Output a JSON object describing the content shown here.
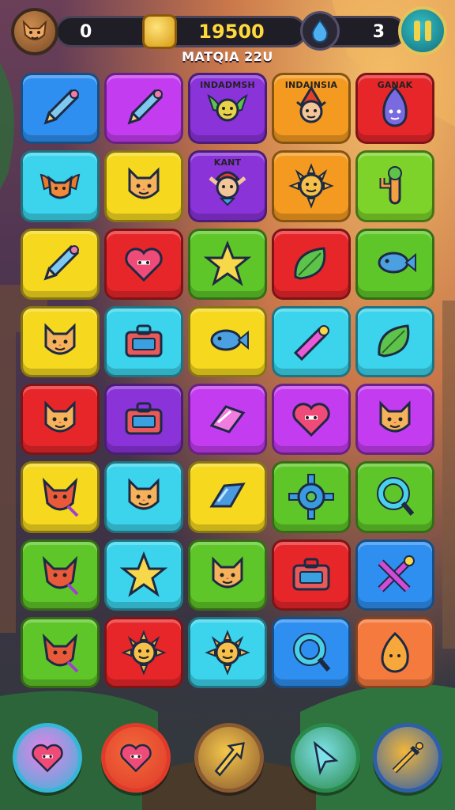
{
  "hud": {
    "left_value": "0",
    "score": "19500",
    "right_value": "3"
  },
  "level_label": "MATQIA 22U",
  "colors": {
    "blue": "#2f8ff0",
    "magenta": "#c43cf0",
    "purple": "#8a33d9",
    "orange": "#f59a20",
    "red": "#e7262a",
    "cyan": "#3bd4ec",
    "yellow": "#f6d81f",
    "green": "#5fc629",
    "lime": "#7ed32a",
    "coral": "#f47a3e"
  },
  "board": {
    "rows": [
      [
        {
          "color": "blue",
          "icon": "pencil-icon",
          "label": ""
        },
        {
          "color": "magenta",
          "icon": "pencil-icon",
          "label": ""
        },
        {
          "color": "purple",
          "icon": "winged-creature-icon",
          "label": "INDADMSH"
        },
        {
          "color": "orange",
          "icon": "gnome-icon",
          "label": "INDAINSIA"
        },
        {
          "color": "red",
          "icon": "flame-creature-icon",
          "label": "GANAK"
        }
      ],
      [
        {
          "color": "cyan",
          "icon": "winged-fox-icon",
          "label": ""
        },
        {
          "color": "yellow",
          "icon": "cat-face-icon",
          "label": ""
        },
        {
          "color": "purple",
          "icon": "elf-icon",
          "label": "KANT"
        },
        {
          "color": "orange",
          "icon": "sun-creature-icon",
          "label": ""
        },
        {
          "color": "lime",
          "icon": "cactus-icon",
          "label": ""
        }
      ],
      [
        {
          "color": "yellow",
          "icon": "pencil-icon",
          "label": ""
        },
        {
          "color": "red",
          "icon": "heart-icon",
          "label": ""
        },
        {
          "color": "green",
          "icon": "star-icon",
          "label": ""
        },
        {
          "color": "red",
          "icon": "leaf-icon",
          "label": ""
        },
        {
          "color": "green",
          "icon": "fish-icon",
          "label": ""
        }
      ],
      [
        {
          "color": "yellow",
          "icon": "cat-face-icon",
          "label": ""
        },
        {
          "color": "cyan",
          "icon": "toolbox-icon",
          "label": ""
        },
        {
          "color": "yellow",
          "icon": "fish-icon",
          "label": ""
        },
        {
          "color": "cyan",
          "icon": "potion-icon",
          "label": ""
        },
        {
          "color": "cyan",
          "icon": "leaf-icon",
          "label": ""
        }
      ],
      [
        {
          "color": "red",
          "icon": "cat-face-icon",
          "label": ""
        },
        {
          "color": "purple",
          "icon": "toolbox-icon",
          "label": ""
        },
        {
          "color": "magenta",
          "icon": "gem-icon",
          "label": ""
        },
        {
          "color": "magenta",
          "icon": "heart-icon",
          "label": ""
        },
        {
          "color": "magenta",
          "icon": "cat-face-icon",
          "label": ""
        }
      ],
      [
        {
          "color": "yellow",
          "icon": "fox-icon",
          "label": ""
        },
        {
          "color": "cyan",
          "icon": "cat-face-icon",
          "label": ""
        },
        {
          "color": "yellow",
          "icon": "crystal-icon",
          "label": ""
        },
        {
          "color": "green",
          "icon": "gear-icon",
          "label": ""
        },
        {
          "color": "green",
          "icon": "ring-icon",
          "label": ""
        }
      ],
      [
        {
          "color": "green",
          "icon": "fox-icon",
          "label": ""
        },
        {
          "color": "cyan",
          "icon": "star-icon",
          "label": ""
        },
        {
          "color": "green",
          "icon": "cat-face-icon",
          "label": ""
        },
        {
          "color": "red",
          "icon": "toolbox-icon",
          "label": ""
        },
        {
          "color": "blue",
          "icon": "crossed-tools-icon",
          "label": ""
        }
      ],
      [
        {
          "color": "green",
          "icon": "fox-icon",
          "label": ""
        },
        {
          "color": "red",
          "icon": "sun-creature-icon",
          "label": ""
        },
        {
          "color": "cyan",
          "icon": "sun-creature-icon",
          "label": ""
        },
        {
          "color": "blue",
          "icon": "ring-icon",
          "label": ""
        },
        {
          "color": "coral",
          "icon": "flame-icon",
          "label": ""
        }
      ]
    ]
  },
  "powerups": [
    {
      "icon": "heart-icon",
      "ring": "#36b6d8",
      "fill": "#f07ee6"
    },
    {
      "icon": "heart-icon",
      "ring": "#e03a2a",
      "fill": "#f26a3a"
    },
    {
      "icon": "arrow-icon",
      "ring": "#8a5a30",
      "fill": "#f4c64a"
    },
    {
      "icon": "cursor-icon",
      "ring": "#2a8a4a",
      "fill": "#7ee0e8"
    },
    {
      "icon": "sword-icon",
      "ring": "#2f5fa8",
      "fill": "#f2b63a"
    }
  ]
}
